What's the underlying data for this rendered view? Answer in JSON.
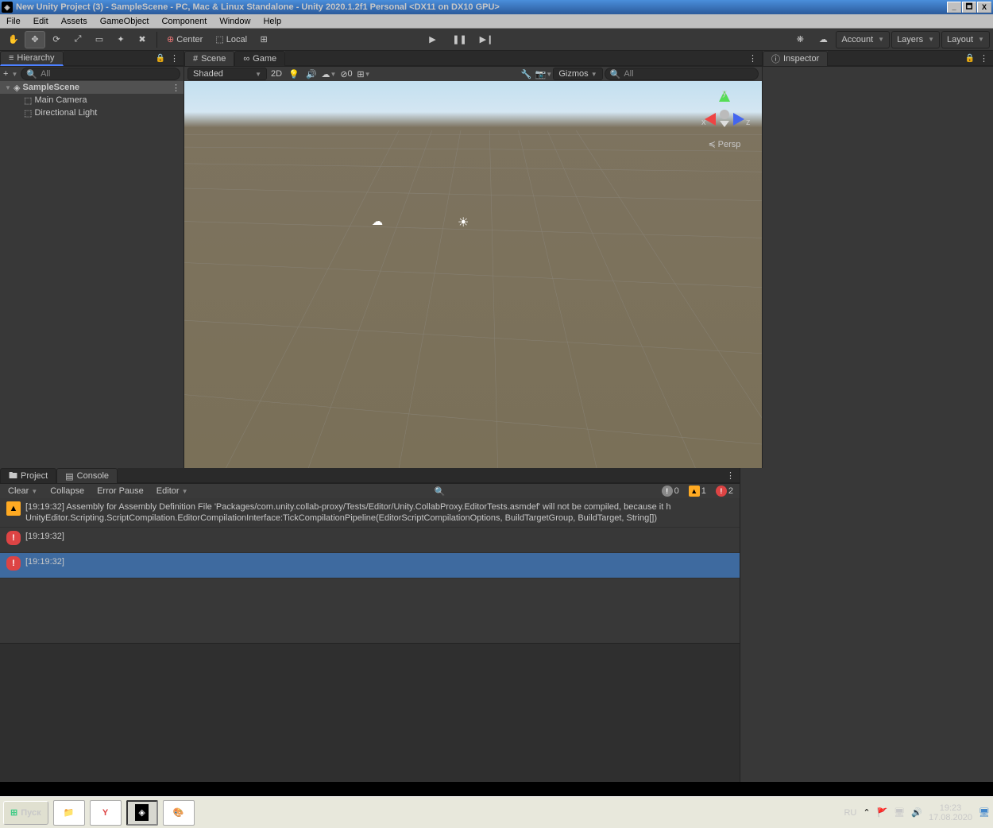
{
  "titlebar": {
    "logo": "◈",
    "title": "New Unity Project (3) - SampleScene - PC, Mac & Linux Standalone - Unity 2020.1.2f1 Personal <DX11 on DX10 GPU>",
    "min": "_",
    "max": "🗖",
    "close": "X"
  },
  "menu": [
    "File",
    "Edit",
    "Assets",
    "GameObject",
    "Component",
    "Window",
    "Help"
  ],
  "toolbar": {
    "tools": [
      {
        "n": "hand",
        "g": "✋"
      },
      {
        "n": "move",
        "g": "✥"
      },
      {
        "n": "rotate",
        "g": "⟳"
      },
      {
        "n": "scale",
        "g": "⤢"
      },
      {
        "n": "rect",
        "g": "▭"
      },
      {
        "n": "transform",
        "g": "✦"
      },
      {
        "n": "custom",
        "g": "✖"
      }
    ],
    "center": "Center",
    "local": "Local",
    "snap": "⊞",
    "play": "▶",
    "pause": "❚❚",
    "step": "▶❙",
    "collab": "☁",
    "account": "Account",
    "layers": "Layers",
    "layout": "Layout",
    "light": "❋"
  },
  "hierarchy": {
    "title": "Hierarchy",
    "plus": "+",
    "search": "All",
    "root": "SampleScene",
    "items": [
      "Main Camera",
      "Directional Light"
    ]
  },
  "scene": {
    "tab_scene": "Scene",
    "tab_game": "Game",
    "shading": "Shaded",
    "twoD": "2D",
    "gizmos": "Gizmos",
    "hidden": "0",
    "search": "All",
    "persp": "Persp",
    "perspArrow": "≼"
  },
  "inspector": {
    "title": "Inspector"
  },
  "console": {
    "tab_project": "Project",
    "tab_console": "Console",
    "clear": "Clear",
    "collapse": "Collapse",
    "errpause": "Error Pause",
    "editor": "Editor",
    "counts": {
      "info": "0",
      "warn": "1",
      "err": "2"
    },
    "logs": [
      {
        "icon": "warn",
        "t1": "[19:19:32] Assembly for Assembly Definition File 'Packages/com.unity.collab-proxy/Tests/Editor/Unity.CollabProxy.EditorTests.asmdef' will not be compiled, because it h",
        "t2": "UnityEditor.Scripting.ScriptCompilation.EditorCompilationInterface:TickCompilationPipeline(EditorScriptCompilationOptions, BuildTargetGroup, BuildTarget, String[])"
      },
      {
        "icon": "err",
        "t1": "[19:19:32]",
        "t2": ""
      },
      {
        "icon": "err",
        "t1": "[19:19:32]",
        "t2": "",
        "sel": true
      }
    ]
  },
  "taskbar": {
    "start": "Пуск",
    "lang": "RU",
    "time": "19:23",
    "date": "17.08.2020"
  }
}
